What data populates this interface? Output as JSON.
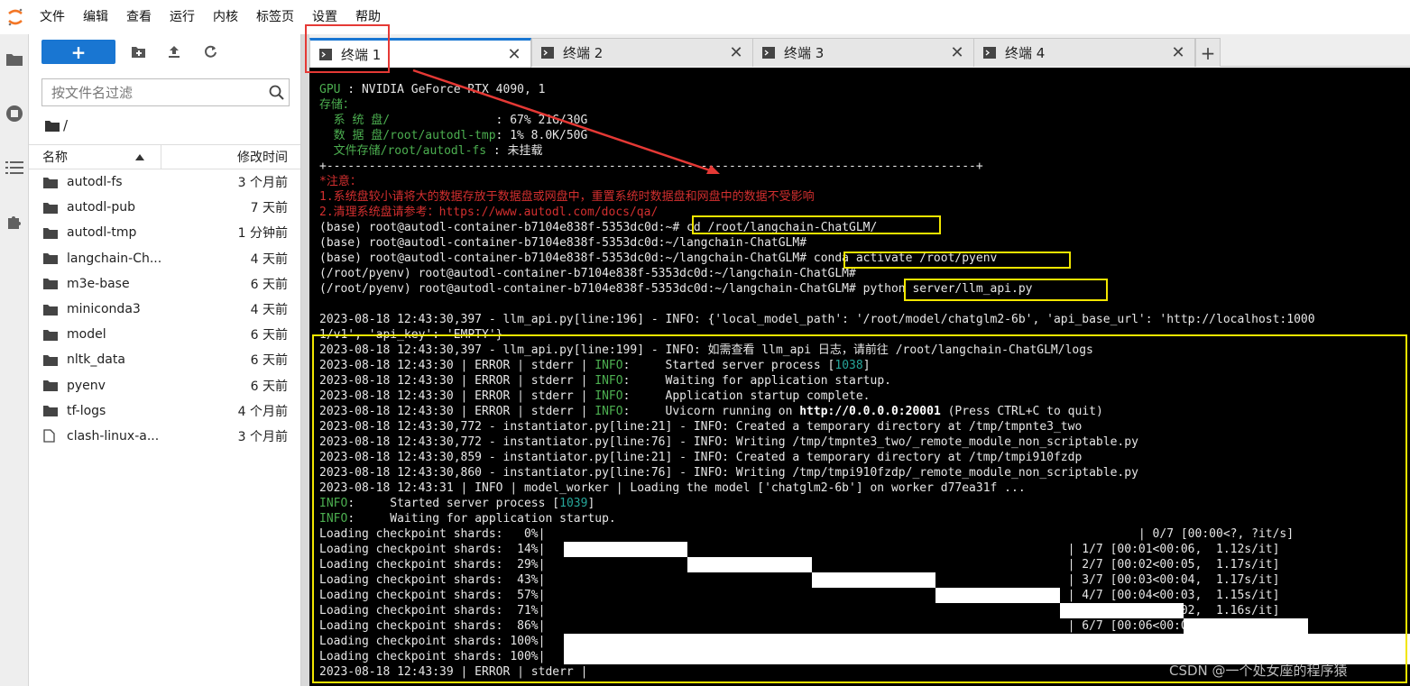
{
  "menubar": {
    "items": [
      "文件",
      "编辑",
      "查看",
      "运行",
      "内核",
      "标签页",
      "设置",
      "帮助"
    ]
  },
  "rail": {
    "icons": [
      "folder-icon",
      "running-icon",
      "toc-icon",
      "extension-icon"
    ]
  },
  "filebrowser": {
    "new_label": "+",
    "search_placeholder": "按文件名过滤",
    "breadcrumb": "/",
    "col_name": "名称",
    "col_modified": "修改时间",
    "files": [
      {
        "name": "autodl-fs",
        "modified": "3 个月前",
        "type": "folder"
      },
      {
        "name": "autodl-pub",
        "modified": "7 天前",
        "type": "folder"
      },
      {
        "name": "autodl-tmp",
        "modified": "1 分钟前",
        "type": "folder"
      },
      {
        "name": "langchain-Ch...",
        "modified": "4 天前",
        "type": "folder"
      },
      {
        "name": "m3e-base",
        "modified": "6 天前",
        "type": "folder"
      },
      {
        "name": "miniconda3",
        "modified": "4 天前",
        "type": "folder"
      },
      {
        "name": "model",
        "modified": "6 天前",
        "type": "folder"
      },
      {
        "name": "nltk_data",
        "modified": "6 天前",
        "type": "folder"
      },
      {
        "name": "pyenv",
        "modified": "6 天前",
        "type": "folder"
      },
      {
        "name": "tf-logs",
        "modified": "4 个月前",
        "type": "folder"
      },
      {
        "name": "clash-linux-a...",
        "modified": "3 个月前",
        "type": "file"
      }
    ]
  },
  "tabs": [
    {
      "label": "终端 1",
      "active": true
    },
    {
      "label": "终端 2",
      "active": false
    },
    {
      "label": "终端 3",
      "active": false
    },
    {
      "label": "终端 4",
      "active": false
    }
  ],
  "tab_close": "✕",
  "tab_add": "+",
  "terminal": {
    "lines": [
      [
        {
          "t": "GPU",
          "c": "g"
        },
        {
          "t": " : NVIDIA GeForce RTX 4090, 1"
        }
      ],
      [
        {
          "t": "存储：",
          "c": "g"
        }
      ],
      [
        {
          "t": "  系 统 盘/",
          "c": "g"
        },
        {
          "t": "               : 67% 21G/30G"
        }
      ],
      [
        {
          "t": "  数 据 盘/root/autodl-tmp",
          "c": "g"
        },
        {
          "t": ": 1% 8.0K/50G"
        }
      ],
      [
        {
          "t": "  文件存储/root/autodl-fs",
          "c": "g"
        },
        {
          "t": " : 未挂载"
        }
      ],
      [
        {
          "t": "+--------------------------------------------------------------------------------------------+"
        }
      ],
      [
        {
          "t": "*注意：",
          "c": "r"
        }
      ],
      [
        {
          "t": "1.系统盘较小请将大的数据存放于数据盘或网盘中，重置系统时数据盘和网盘中的数据不受影响",
          "c": "r"
        }
      ],
      [
        {
          "t": "2.清理系统盘请参考：https://www.autodl.com/docs/qa/",
          "c": "r"
        }
      ],
      [
        {
          "t": "(base) root@autodl-container-b7104e838f-5353dc0d:~# cd /root/langchain-ChatGLM/"
        }
      ],
      [
        {
          "t": "(base) root@autodl-container-b7104e838f-5353dc0d:~/langchain-ChatGLM#"
        }
      ],
      [
        {
          "t": "(base) root@autodl-container-b7104e838f-5353dc0d:~/langchain-ChatGLM# conda activate /root/pyenv"
        }
      ],
      [
        {
          "t": "(/root/pyenv) root@autodl-container-b7104e838f-5353dc0d:~/langchain-ChatGLM#"
        }
      ],
      [
        {
          "t": "(/root/pyenv) root@autodl-container-b7104e838f-5353dc0d:~/langchain-ChatGLM# python server/llm_api.py"
        }
      ],
      [
        {
          "t": ""
        }
      ],
      [
        {
          "t": "2023-08-18 12:43:30,397 - llm_api.py[line:196] - INFO: {'local_model_path': '/root/model/chatglm2-6b', 'api_base_url': 'http://localhost:1000"
        }
      ],
      [
        {
          "t": "1/v1', 'api_key': 'EMPTY'}"
        }
      ],
      [
        {
          "t": "2023-08-18 12:43:30,397 - llm_api.py[line:199] - INFO: 如需查看 llm_api 日志，请前往 /root/langchain-ChatGLM/logs"
        }
      ],
      [
        {
          "t": "2023-08-18 12:43:30 | ERROR | stderr | "
        },
        {
          "t": "INFO",
          "c": "g"
        },
        {
          "t": ":     Started server process ["
        },
        {
          "t": "1038",
          "c": "c"
        },
        {
          "t": "]"
        }
      ],
      [
        {
          "t": "2023-08-18 12:43:30 | ERROR | stderr | "
        },
        {
          "t": "INFO",
          "c": "g"
        },
        {
          "t": ":     Waiting for application startup."
        }
      ],
      [
        {
          "t": "2023-08-18 12:43:30 | ERROR | stderr | "
        },
        {
          "t": "INFO",
          "c": "g"
        },
        {
          "t": ":     Application startup complete."
        }
      ],
      [
        {
          "t": "2023-08-18 12:43:30 | ERROR | stderr | "
        },
        {
          "t": "INFO",
          "c": "g"
        },
        {
          "t": ":     Uvicorn running on "
        },
        {
          "t": "http://0.0.0.0:20001",
          "c": "b"
        },
        {
          "t": " (Press CTRL+C to quit)"
        }
      ],
      [
        {
          "t": "2023-08-18 12:43:30,772 - instantiator.py[line:21] - INFO: Created a temporary directory at /tmp/tmpnte3_two"
        }
      ],
      [
        {
          "t": "2023-08-18 12:43:30,772 - instantiator.py[line:76] - INFO: Writing /tmp/tmpnte3_two/_remote_module_non_scriptable.py"
        }
      ],
      [
        {
          "t": "2023-08-18 12:43:30,859 - instantiator.py[line:21] - INFO: Created a temporary directory at /tmp/tmpi910fzdp"
        }
      ],
      [
        {
          "t": "2023-08-18 12:43:30,860 - instantiator.py[line:76] - INFO: Writing /tmp/tmpi910fzdp/_remote_module_non_scriptable.py"
        }
      ],
      [
        {
          "t": "2023-08-18 12:43:31 | INFO | model_worker | Loading the model ['chatglm2-6b'] on worker d77ea31f ..."
        }
      ],
      [
        {
          "t": "INFO",
          "c": "g"
        },
        {
          "t": ":     Started server process ["
        },
        {
          "t": "1039",
          "c": "c"
        },
        {
          "t": "]"
        }
      ],
      [
        {
          "t": "INFO",
          "c": "g"
        },
        {
          "t": ":     Waiting for application startup."
        }
      ],
      [
        {
          "t": "Loading checkpoint shards:   0%|                                                                                    | 0/7 [00:00<?, ?it/s]"
        }
      ],
      [
        {
          "t": "Loading checkpoint shards:  14%|                                                                          | 1/7 [00:01<00:06,  1.12s/it]"
        }
      ],
      [
        {
          "t": "Loading checkpoint shards:  29%|                                                                          | 2/7 [00:02<00:05,  1.17s/it]"
        }
      ],
      [
        {
          "t": "Loading checkpoint shards:  43%|                                                                          | 3/7 [00:03<00:04,  1.17s/it]"
        }
      ],
      [
        {
          "t": "Loading checkpoint shards:  57%|                                                                          | 4/7 [00:04<00:03,  1.15s/it]"
        }
      ],
      [
        {
          "t": "Loading checkpoint shards:  71%|                                                                          | 5/7 [00:05<00:02,  1.16s/it]"
        }
      ],
      [
        {
          "t": "Loading checkpoint shards:  86%|                                                                          | 6/7 [00:06<00:01,  1.16s/it]"
        }
      ],
      [
        {
          "t": "Loading checkpoint shards: 100%|                                                                          | 7/7 [00:07<00:00,  1.00s/it]"
        }
      ],
      [
        {
          "t": "Loading checkpoint shards: 100%|                                                                          | 7/7 [00:07<00:00,  1.09s/it]"
        }
      ],
      [
        {
          "t": "2023-08-18 12:43:39 | ERROR | stderr |"
        }
      ]
    ],
    "progress_fractions": [
      0,
      0.142857,
      0.285714,
      0.428571,
      0.571429,
      0.714286,
      0.857143,
      1.0,
      1.0
    ]
  },
  "watermark": "CSDN @一个处女座的程序猿",
  "colors": {
    "accent": "#1976d2",
    "annotation_red": "#e53935",
    "annotation_yellow": "#f2e600",
    "terminal_green": "#4caf50",
    "terminal_red": "#d32f2f"
  }
}
